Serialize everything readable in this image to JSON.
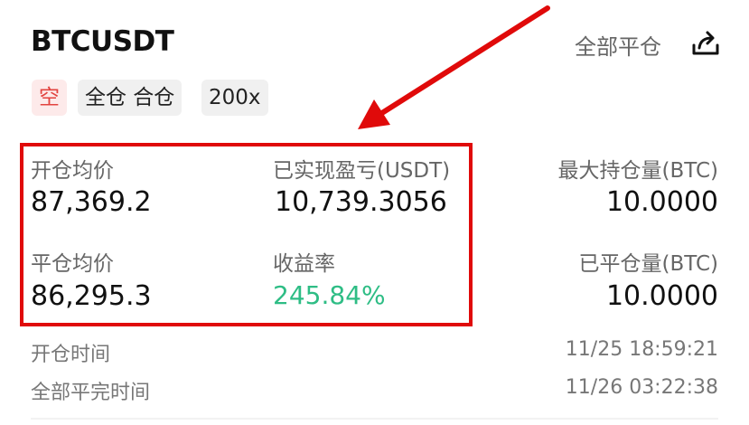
{
  "header": {
    "symbol": "BTCUSDT",
    "close_all_label": "全部平仓",
    "share_icon": "share-icon"
  },
  "tags": {
    "side": "空",
    "margin_mode": "全仓 合仓",
    "leverage": "200x"
  },
  "stats": {
    "avg_open_price_label": "开仓均价",
    "avg_open_price": "87,369.2",
    "realized_pnl_label": "已实现盈亏(USDT)",
    "realized_pnl": "10,739.3056",
    "max_position_label": "最大持仓量(BTC)",
    "max_position": "10.0000",
    "avg_close_price_label": "平仓均价",
    "avg_close_price": "86,295.3",
    "roi_label": "收益率",
    "roi": "245.84%",
    "closed_position_label": "已平仓量(BTC)",
    "closed_position": "10.0000"
  },
  "times": {
    "open_time_label": "开仓时间",
    "open_time": "11/25 18:59:21",
    "close_time_label": "全部平完时间",
    "close_time": "11/26 03:22:38"
  },
  "colors": {
    "highlight_red": "#e00a0a",
    "profit_green": "#2ebd85",
    "short_red": "#e2433f"
  }
}
